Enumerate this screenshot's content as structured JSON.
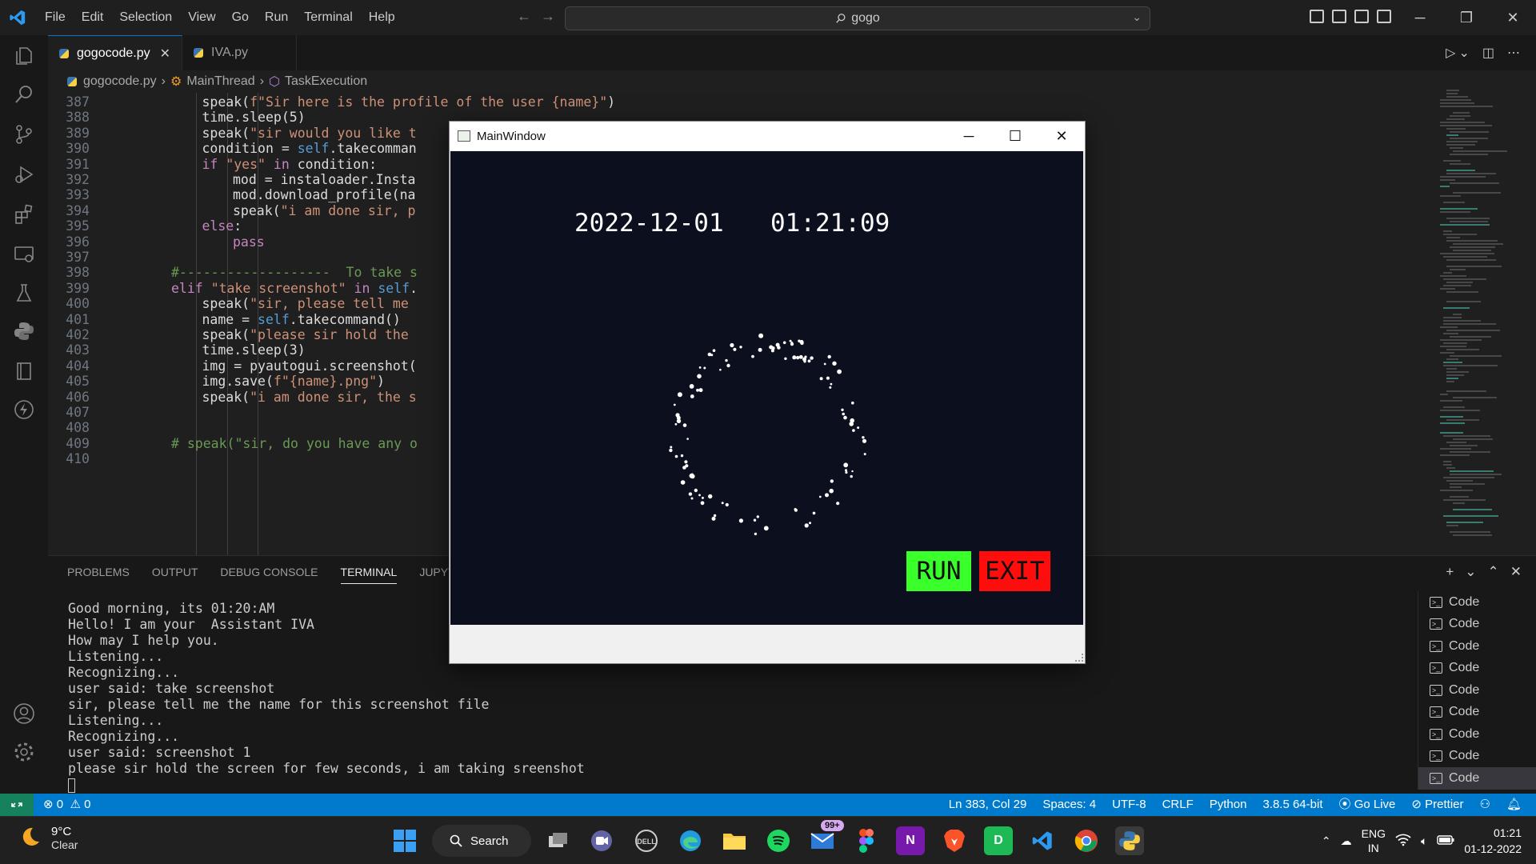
{
  "menu": [
    "File",
    "Edit",
    "Selection",
    "View",
    "Go",
    "Run",
    "Terminal",
    "Help"
  ],
  "command_center": {
    "text": "gogo"
  },
  "tabs": [
    {
      "label": "gogocode.py",
      "active": true
    },
    {
      "label": "IVA.py",
      "active": false
    }
  ],
  "breadcrumb": {
    "file": "gogocode.py",
    "class": "MainThread",
    "method": "TaskExecution"
  },
  "code_lines": [
    {
      "n": "387",
      "indent": 6,
      "text": "speak(f\"Sir here is the profile of the user {name}\")"
    },
    {
      "n": "388",
      "indent": 6,
      "text": "time.sleep(5)"
    },
    {
      "n": "389",
      "indent": 6,
      "text": "speak(\"sir would you like t"
    },
    {
      "n": "390",
      "indent": 6,
      "text": "condition = self.takecomman"
    },
    {
      "n": "391",
      "indent": 6,
      "text": "if \"yes\" in condition:"
    },
    {
      "n": "392",
      "indent": 7,
      "text": "mod = instaloader.Insta"
    },
    {
      "n": "393",
      "indent": 7,
      "text": "mod.download_profile(na"
    },
    {
      "n": "394",
      "indent": 7,
      "text": "speak(\"i am done sir, p"
    },
    {
      "n": "395",
      "indent": 6,
      "text": "else:"
    },
    {
      "n": "396",
      "indent": 7,
      "text": "pass"
    },
    {
      "n": "397",
      "indent": 0,
      "text": ""
    },
    {
      "n": "398",
      "indent": 5,
      "text": "#-------------------  To take s"
    },
    {
      "n": "399",
      "indent": 5,
      "text": "elif \"take screenshot\" in self."
    },
    {
      "n": "400",
      "indent": 6,
      "text": "speak(\"sir, please tell me"
    },
    {
      "n": "401",
      "indent": 6,
      "text": "name = self.takecommand()"
    },
    {
      "n": "402",
      "indent": 6,
      "text": "speak(\"please sir hold the"
    },
    {
      "n": "403",
      "indent": 6,
      "text": "time.sleep(3)"
    },
    {
      "n": "404",
      "indent": 6,
      "text": "img = pyautogui.screenshot("
    },
    {
      "n": "405",
      "indent": 6,
      "text": "img.save(f\"{name}.png\")"
    },
    {
      "n": "406",
      "indent": 6,
      "text": "speak(\"i am done sir, the s"
    },
    {
      "n": "407",
      "indent": 0,
      "text": ""
    },
    {
      "n": "408",
      "indent": 0,
      "text": ""
    },
    {
      "n": "409",
      "indent": 5,
      "text": "# speak(\"sir, do you have any o"
    },
    {
      "n": "410",
      "indent": 0,
      "text": ""
    }
  ],
  "panel": {
    "tabs": [
      "PROBLEMS",
      "OUTPUT",
      "DEBUG CONSOLE",
      "TERMINAL",
      "JUPYTER"
    ],
    "active_tab": "TERMINAL",
    "terminal_lines": [
      "Good morning, its 01:20:AM",
      "Hello! I am your  Assistant IVA",
      "How may I help you.",
      "Listening...",
      "Recognizing...",
      "user said: take screenshot",
      "sir, please tell me the name for this screenshot file",
      "Listening...",
      "Recognizing...",
      "user said: screenshot 1",
      "please sir hold the screen for few seconds, i am taking sreenshot"
    ],
    "terminal_instances": [
      "Code",
      "Code",
      "Code",
      "Code",
      "Code",
      "Code",
      "Code",
      "Code",
      "Code"
    ]
  },
  "statusbar": {
    "errors": "0",
    "warnings": "0",
    "items": [
      "Ln 383, Col 29",
      "Spaces: 4",
      "UTF-8",
      "CRLF",
      "Python",
      "3.8.5 64-bit",
      "Go Live",
      "Prettier"
    ]
  },
  "qt_window": {
    "title": "MainWindow",
    "date": "2022-12-01",
    "time": "01:21:09",
    "run_label": "RUN",
    "exit_label": "EXIT",
    "colors": {
      "canvas": "#0c0f1e",
      "run": "#39ff2b",
      "exit": "#ff0d0d"
    }
  },
  "taskbar": {
    "weather_temp": "9°C",
    "weather_cond": "Clear",
    "search_label": "Search",
    "mail_badge": "99+",
    "lang_1": "ENG",
    "lang_2": "IN",
    "time": "01:21",
    "date": "01-12-2022"
  },
  "icons": [
    "explorer-icon",
    "search-icon",
    "source-control-icon",
    "run-debug-icon",
    "extensions-icon",
    "remote-explorer-icon",
    "testing-icon",
    "python-icon",
    "notebook-icon",
    "thunder-icon",
    "account-icon",
    "settings-gear-icon"
  ]
}
